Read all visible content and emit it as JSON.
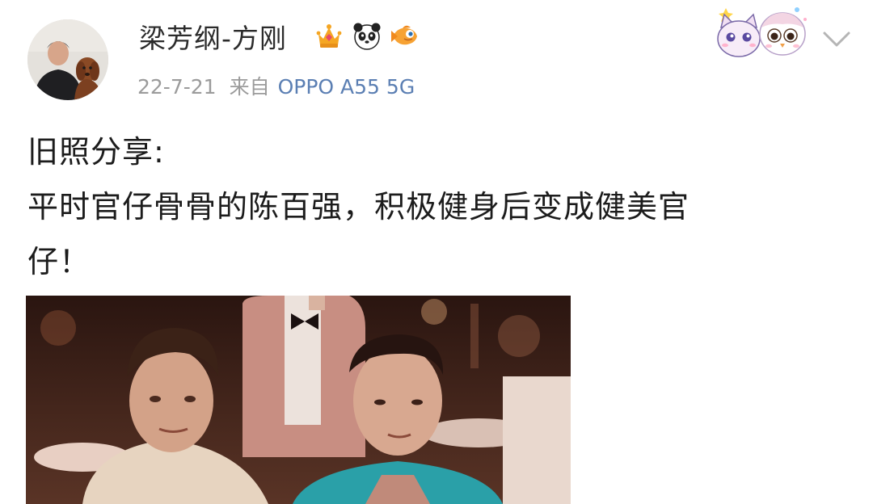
{
  "post": {
    "author": {
      "name": "梁芳纲-方刚",
      "badges": [
        "crown-badge-icon",
        "panda-badge-icon",
        "goldfish-badge-icon"
      ]
    },
    "date": "22-7-21",
    "via_label": "来自",
    "device": "OPPO A55 5G",
    "text_lines": [
      "旧照分享:",
      "平时官仔骨骨的陈百强，积极健身后变成健美官",
      "仔！"
    ],
    "image": {
      "icon": "photo-two-men-restaurant"
    }
  },
  "colors": {
    "text": "#1c1c1c",
    "meta": "#9b9b9b",
    "device_link": "#5b7fb3",
    "background": "#ffffff"
  },
  "header": {
    "decoration_icon": "cartoon-sticker-icon",
    "menu_icon": "chevron-down-icon"
  }
}
